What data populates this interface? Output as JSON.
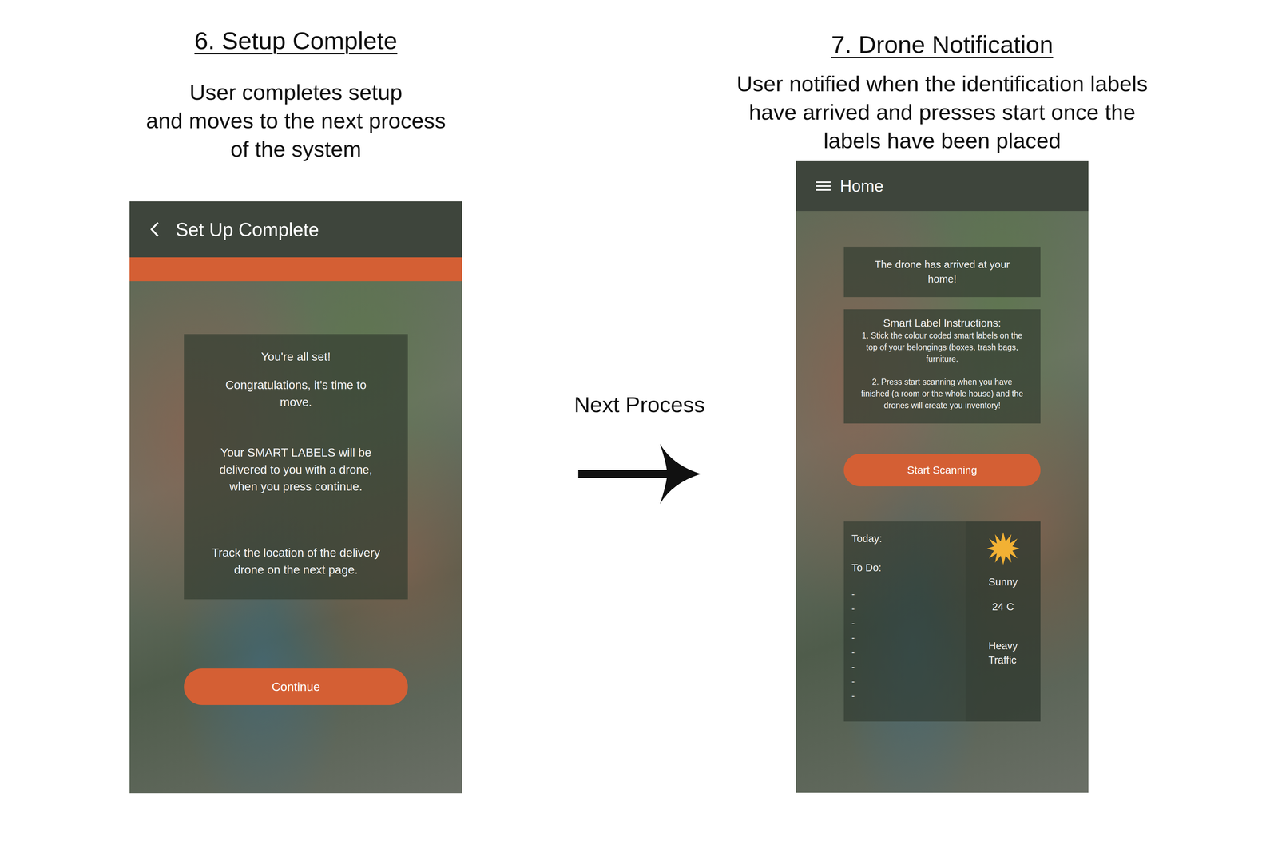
{
  "steps": [
    {
      "title": "6. Setup Complete",
      "description": [
        "User completes setup",
        "and moves to the next process",
        "of the system"
      ]
    },
    {
      "title": "7. Drone Notification",
      "description": [
        "User notified when the identification labels",
        "have arrived and presses start once the",
        "labels have been placed"
      ]
    }
  ],
  "connector": {
    "label": "Next Process"
  },
  "setup_screen": {
    "header": "Set Up Complete",
    "messages": [
      [
        "You're all set!"
      ],
      [
        "Congratulations, it's time to",
        "move."
      ],
      [
        "Your SMART LABELS will be",
        "delivered to you with a drone,",
        "when you press continue."
      ],
      [
        "Track the location of the delivery",
        "drone on the next page."
      ]
    ],
    "button": "Continue"
  },
  "home_screen": {
    "header": "Home",
    "notification": [
      "The drone has arrived at your",
      "home!"
    ],
    "instructions": {
      "title": "Smart Label Instructions:",
      "items": [
        [
          "1. Stick the colour coded smart labels on the",
          "top of your belongings (boxes, trash bags,",
          "furniture."
        ],
        [
          "2. Press start scanning when you have",
          "finished (a room or the whole house) and the",
          "drones will create you inventory!"
        ]
      ]
    },
    "button": "Start Scanning",
    "today": {
      "label": "Today:",
      "todo_label": "To Do:",
      "todo_items": [
        "-",
        "-",
        "-",
        "-",
        "-",
        "-",
        "-",
        "-"
      ]
    },
    "weather": {
      "condition": "Sunny",
      "temperature": "24 C",
      "traffic": [
        "Heavy",
        "Traffic"
      ]
    }
  }
}
